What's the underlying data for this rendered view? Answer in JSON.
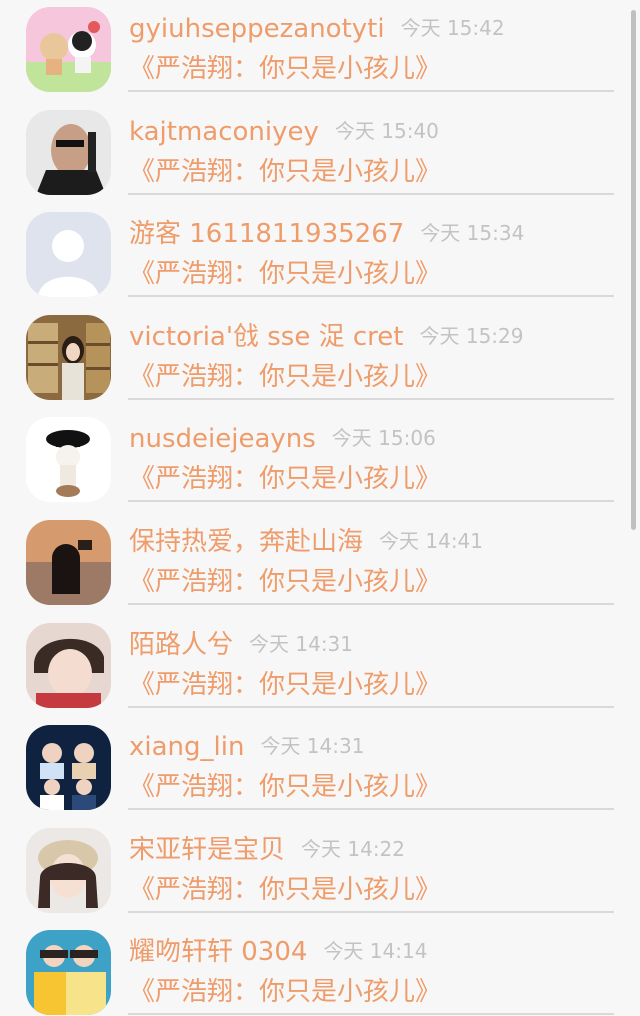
{
  "colors": {
    "accent": "#ef9c6b",
    "timestamp": "#c3c3c3",
    "divider": "#d9d9d9",
    "background": "#f7f7f7"
  },
  "rows": [
    {
      "name": "gyiuhseppezanotyti",
      "time": "今天 15:42",
      "title": "《严浩翔：你只是小孩儿》",
      "avatar_icon": "cartoon-couple-icon"
    },
    {
      "name": "kajtmaconiyey",
      "time": "今天 15:40",
      "title": "《严浩翔：你只是小孩儿》",
      "avatar_icon": "man-with-gun-icon"
    },
    {
      "name": "游客 1611811935267",
      "time": "今天 15:34",
      "title": "《严浩翔：你只是小孩儿》",
      "avatar_icon": "default-user-icon"
    },
    {
      "name": "victoria'戗 sse 浞 cret",
      "time": "今天 15:29",
      "title": "《严浩翔：你只是小孩儿》",
      "avatar_icon": "bookshelf-girl-icon"
    },
    {
      "name": "nusdeiejeayns",
      "time": "今天 15:06",
      "title": "《严浩翔：你只是小孩儿》",
      "avatar_icon": "police-cap-figure-icon"
    },
    {
      "name": "保持热爱，奔赴山海",
      "time": "今天 14:41",
      "title": "《严浩翔：你只是小孩儿》",
      "avatar_icon": "sunset-girl-icon"
    },
    {
      "name": "陌路人兮",
      "time": "今天 14:31",
      "title": "《严浩翔：你只是小孩儿》",
      "avatar_icon": "boy-portrait-icon"
    },
    {
      "name": "xiang_lin",
      "time": "今天 14:31",
      "title": "《严浩翔：你只是小孩儿》",
      "avatar_icon": "two-boys-icon"
    },
    {
      "name": "宋亚轩是宝贝",
      "time": "今天 14:22",
      "title": "《严浩翔：你只是小孩儿》",
      "avatar_icon": "girl-portrait-icon"
    },
    {
      "name": "耀吻轩轩 0304",
      "time": "今天 14:14",
      "title": "《严浩翔：你只是小孩儿》",
      "avatar_icon": "two-boys-yellow-icon"
    }
  ]
}
